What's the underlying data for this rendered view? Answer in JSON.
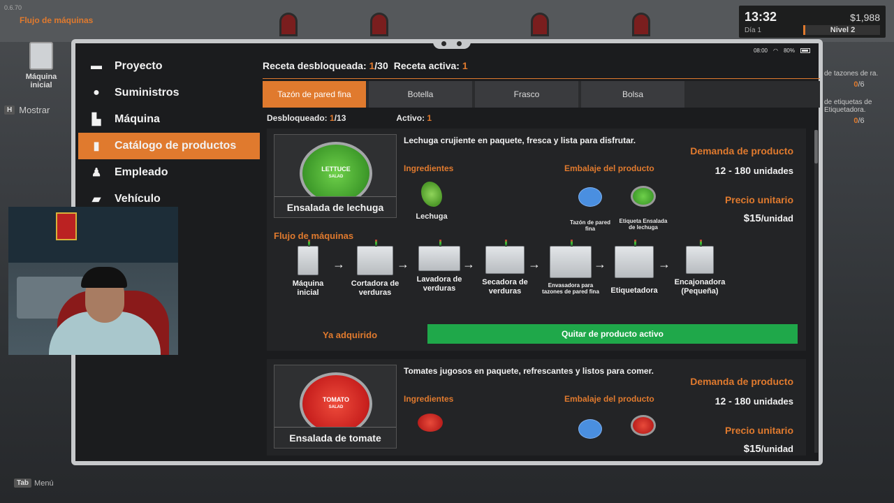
{
  "hud": {
    "version": "0.6.70",
    "flow_title": "Flujo de máquinas",
    "machine_label": "Máquina inicial",
    "show_key": "H",
    "show_label": "Mostrar",
    "menu_key": "Tab",
    "menu_label": "Menú",
    "time": "13:32",
    "day": "Día 1",
    "money": "$1,988",
    "level": "Nivel 2",
    "tasks": [
      {
        "text": "de tazones de ra.",
        "progress_done": "0",
        "progress_total": "/6"
      },
      {
        "text": "de etiquetas de Etiquetadora.",
        "progress_done": "0",
        "progress_total": "/6"
      }
    ]
  },
  "tablet": {
    "status_time": "08:00",
    "status_battery": "80%"
  },
  "sidebar": {
    "items": [
      {
        "label": "Proyecto",
        "icon": "folder-icon"
      },
      {
        "label": "Suministros",
        "icon": "tomato-icon"
      },
      {
        "label": "Máquina",
        "icon": "machine-icon"
      },
      {
        "label": "Catálogo de productos",
        "icon": "book-icon",
        "active": true
      },
      {
        "label": "Empleado",
        "icon": "employee-icon"
      },
      {
        "label": "Vehículo",
        "icon": "vehicle-icon"
      }
    ]
  },
  "header": {
    "unlocked_label": "Receta desbloqueada:",
    "unlocked_count": "1",
    "unlocked_total": "/30",
    "active_label": "Receta activa:",
    "active_count": "1"
  },
  "tabs": [
    {
      "label": "Tazón de pared fina",
      "active": true
    },
    {
      "label": "Botella"
    },
    {
      "label": "Frasco"
    },
    {
      "label": "Bolsa"
    }
  ],
  "subheader": {
    "unlocked_label": "Desbloqueado:",
    "unlocked_count": "1",
    "unlocked_total": "/13",
    "active_label": "Activo:",
    "active_count": "1"
  },
  "products": [
    {
      "name": "Ensalada de lechuga",
      "plate_text": "LETTUCE",
      "plate_sub": "SALAD",
      "description": "Lechuga crujiente en paquete, fresca y lista para disfrutar.",
      "ingredients_label": "Ingredientes",
      "ingredients": [
        "Lechuga"
      ],
      "packaging_label": "Embalaje del producto",
      "packaging": [
        "Tazón de pared fina",
        "Etiqueta Ensalada de lechuga"
      ],
      "demand_label": "Demanda de producto",
      "demand_value": "12 - 180",
      "demand_unit": "unidades",
      "price_label": "Precio unitario",
      "price_value": "$15",
      "price_unit": "/unidad",
      "flow_label": "Flujo de máquinas",
      "machines": [
        "Máquina inicial",
        "Cortadora de verduras",
        "Lavadora de verduras",
        "Secadora de verduras",
        "Envasadora para tazones de pared fina",
        "Etiquetadora",
        "Encajonadora (Pequeña)"
      ],
      "status": "Ya adquirido",
      "action": "Quitar de producto activo",
      "colors": {
        "plate": "#4caf3a",
        "action": "#1fa84a"
      }
    },
    {
      "name": "Ensalada de tomate",
      "plate_text": "TOMATO",
      "plate_sub": "SALAD",
      "description": "Tomates jugosos en paquete, refrescantes y listos para comer.",
      "ingredients_label": "Ingredientes",
      "packaging_label": "Embalaje del producto",
      "demand_label": "Demanda de producto",
      "demand_value": "12 - 180",
      "demand_unit": "unidades",
      "price_label": "Precio unitario",
      "price_value": "$15",
      "price_unit": "/unidad",
      "colors": {
        "plate": "#d4272b"
      }
    }
  ],
  "colors": {
    "accent": "#e07a2e",
    "success": "#1fa84a",
    "panel": "#1b1c1e"
  }
}
